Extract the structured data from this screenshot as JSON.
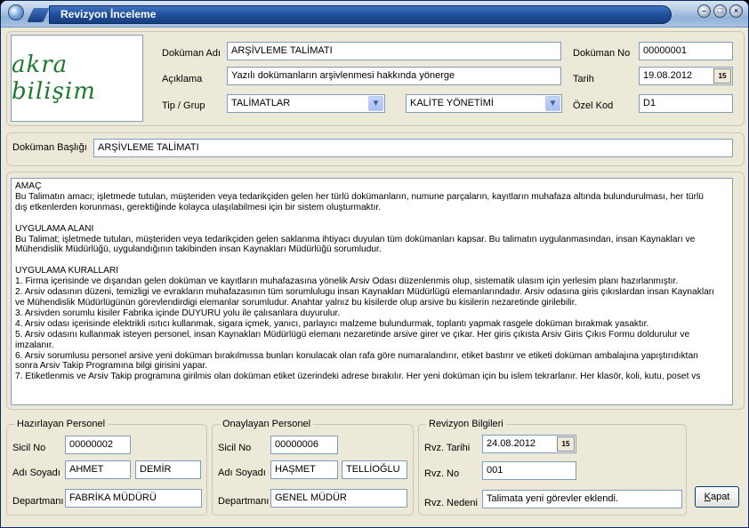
{
  "window": {
    "title": "Revizyon İnceleme",
    "buttons": {
      "minimize": "–",
      "maximize": "□",
      "close": "×"
    }
  },
  "logo": {
    "text": "akra bilişim"
  },
  "header": {
    "doc_name_label": "Doküman Adı",
    "doc_name_value": "ARŞİVLEME TALİMATI",
    "description_label": "Açıklama",
    "description_value": "Yazılı dokümanların arşivlenmesi hakkında yönerge",
    "type_group_label": "Tip / Grup",
    "type_value": "TALİMATLAR",
    "group_value": "KALİTE YÖNETİMİ",
    "doc_no_label": "Doküman No",
    "doc_no_value": "00000001",
    "date_label": "Tarih",
    "date_value": "19.08.2012",
    "special_code_label": "Özel Kod",
    "special_code_value": "D1",
    "calendar_icon_text": "15"
  },
  "title_section": {
    "label": "Doküman Başlığı",
    "value": "ARŞİVLEME TALİMATI"
  },
  "memo": {
    "lines": [
      "AMAÇ",
      "Bu Talimatın amacı; işletmede tutulan, müşteriden veya tedarikçiden gelen her türlü dokümanların, numune parçaların, kayıtların muhafaza altında bulundurulması, her türlü",
      "dış etkenlerden korunması, gerektiğinde kolayca ulaşılabilmesi için bir sistem oluşturmaktır.",
      "",
      "UYGULAMA ALANI",
      "Bu Talimat; işletmede tutulan, müşteriden veya tedarikçiden gelen saklanma ihtiyacı duyulan tüm dokümanları kapsar. Bu talimatın uygulanmasından, insan Kaynakları ve",
      "Mühendislik Müdürlüğü, uygulandığının takibinden insan Kaynakları Müdürlüğü sorumludur.",
      "",
      "UYGULAMA KURALLARI",
      "1. Firma içerisinde ve dışarıdan gelen doküman ve kayıtların muhafazasına yönelik Arsiv Odası düzenlenmis olup, sistematik ulasım için yerlesim planı hazırlanmıştır.",
      "2. Arsiv odasının düzeni, temizligi ve evrakların muhafazasının tüm sorumlulugu insan Kaynakları Müdürlügü elemanlarındadır. Arsiv odasına giris çıkıslardan insan Kaynakları",
      "ve Mühendislik Müdürlügünün görevlendirdigi elemanlar sorumludur. Anahtar yalnız bu kisilerde olup arsive bu kisilerin nezaretinde girilebilir.",
      "3. Arsivden sorumlu kisiler Fabrika içinde DUYURU yolu ile çalısanlara duyurulur.",
      "4. Arsiv odası içerisinde elektrikli ısıtıcı kullanmak, sigara içmek, yanıcı, parlayıcı malzeme bulundurmak, toplantı yapmak rasgele doküman bırakmak yasaktır.",
      "5. Arsiv odasını kullanmak isteyen personel, insan Kaynakları Müdürlügü elemanı nezaretinde arsive girer ve çıkar. Her giris çıkısta Arsiv Giris Çıkıs Formu doldurulur ve",
      "imzalanır.",
      "6. Arsiv sorumlusu personel arsive yeni doküman bırakılmıssa bunları konulacak olan rafa göre numaralandırır, etiket bastırır ve etiketi doküman ambalajına yapıştırıdıktan",
      "sonra Arsiv Takip Programına bilgi girisini yapar.",
      "7. Etiketlenmis ve Arsiv Takip programına girilmis olan doküman etiket üzerindeki adrese bırakılır. Her yeni doküman için bu islem tekrarlanır. Her klasör, koli, kutu, poset vs"
    ]
  },
  "preparer": {
    "title": "Hazırlayan Personel",
    "sicil_label": "Sicil No",
    "sicil_value": "00000002",
    "name_label": "Adı Soyadı",
    "first_name": "AHMET",
    "last_name": "DEMİR",
    "dept_label": "Departmanı",
    "dept_value": "FABRİKA MÜDÜRÜ"
  },
  "approver": {
    "title": "Onaylayan Personel",
    "sicil_label": "Sicil No",
    "sicil_value": "00000006",
    "name_label": "Adı Soyadı",
    "first_name": "HAŞMET",
    "last_name": "TELLİOĞLU",
    "dept_label": "Departmanı",
    "dept_value": "GENEL MÜDÜR"
  },
  "revision": {
    "title": "Revizyon Bilgileri",
    "date_label": "Rvz. Tarihi",
    "date_value": "24.08.2012",
    "no_label": "Rvz. No",
    "no_value": "001",
    "reason_label": "Rvz. Nedeni",
    "reason_value": "Talimata yeni görevler eklendi.",
    "calendar_icon_text": "15"
  },
  "close_button": {
    "label": "Kapat"
  }
}
